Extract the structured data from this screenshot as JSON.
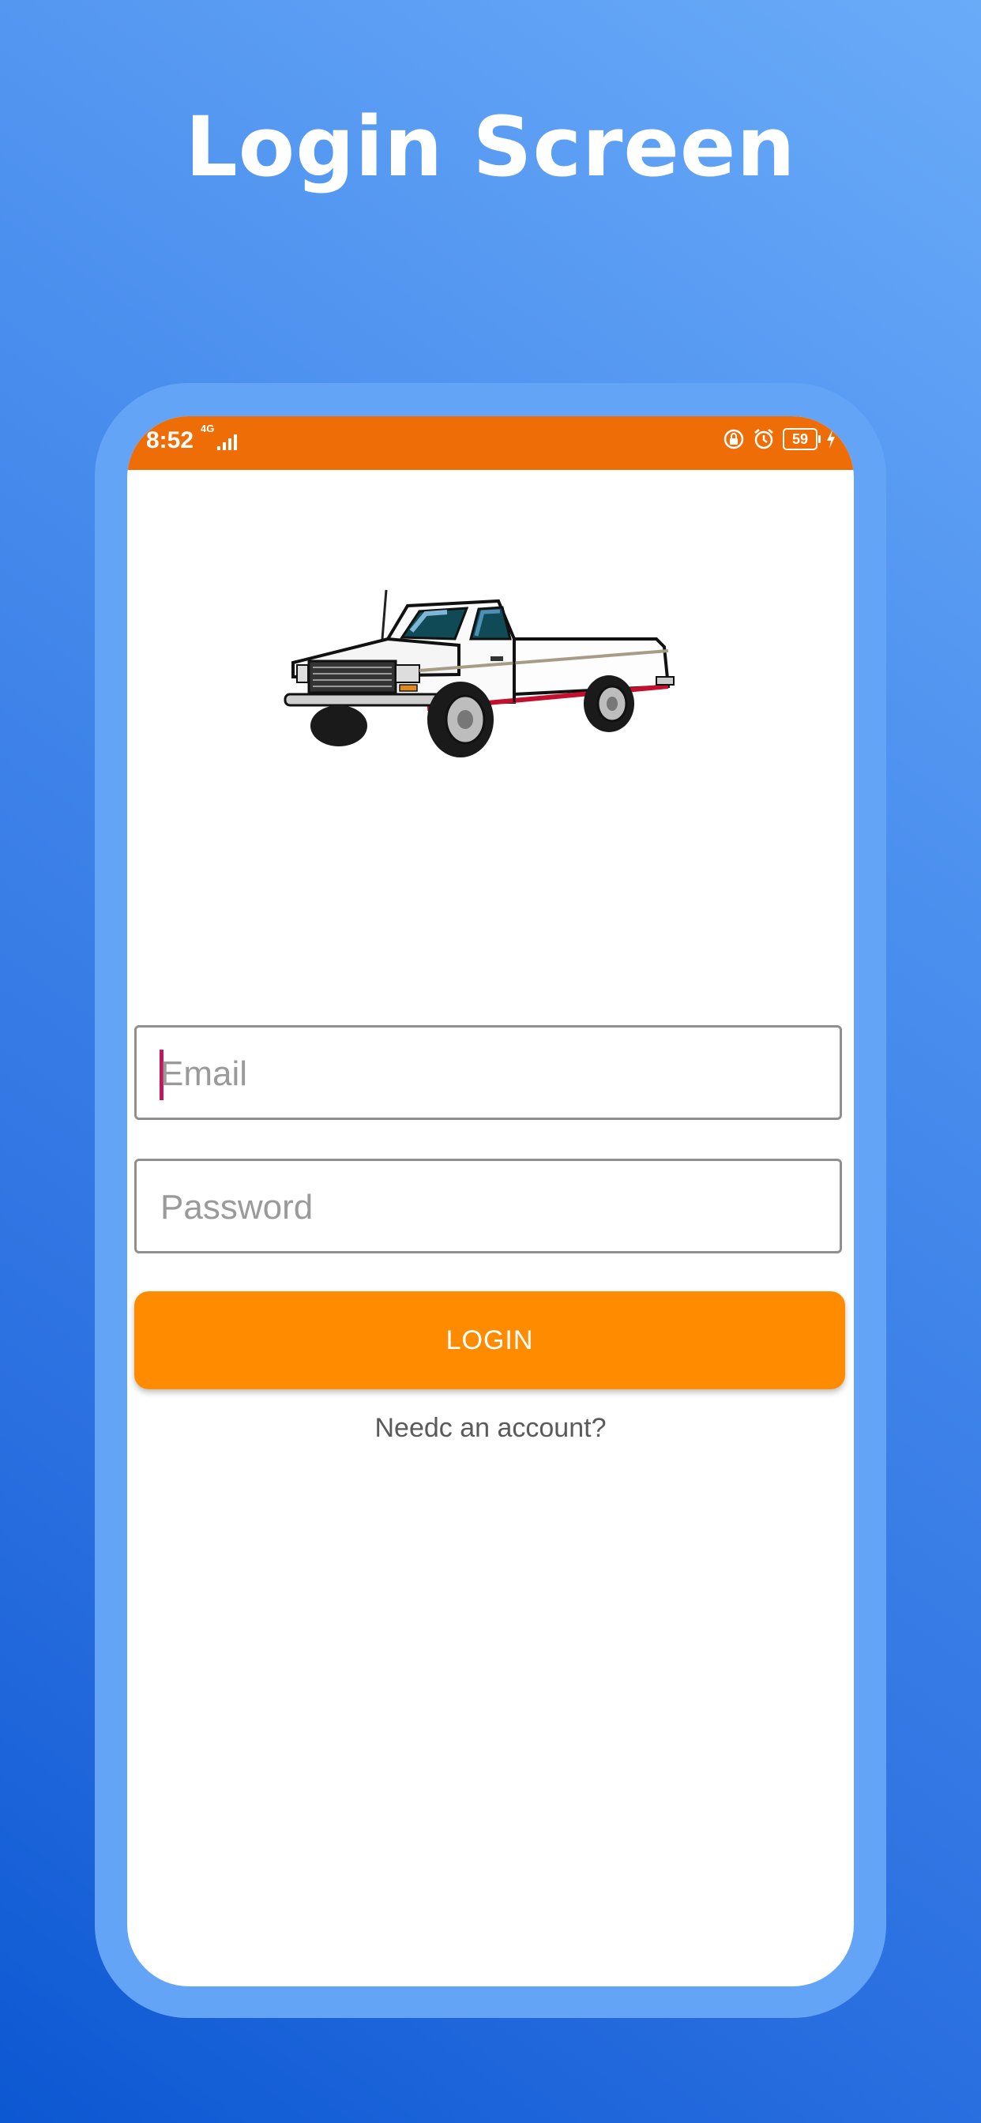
{
  "headline": "Login Screen",
  "status_bar": {
    "time": "8:52",
    "network": "4G",
    "battery": "59",
    "icons": [
      "signal-icon",
      "screen-lock-icon",
      "alarm-icon",
      "battery-icon",
      "charging-icon"
    ],
    "color": "#ee6d06"
  },
  "illustration": {
    "icon": "pickup-truck-illustration"
  },
  "form": {
    "email_placeholder": "Email",
    "password_placeholder": "Password",
    "login_label": "LOGIN",
    "account_link": "Needc an account?"
  },
  "colors": {
    "accent": "#ff8c00",
    "caret": "#c2185b",
    "frame": "#64a4f6",
    "background_top": "#6aabf8",
    "background_bottom": "#0c58d2"
  }
}
